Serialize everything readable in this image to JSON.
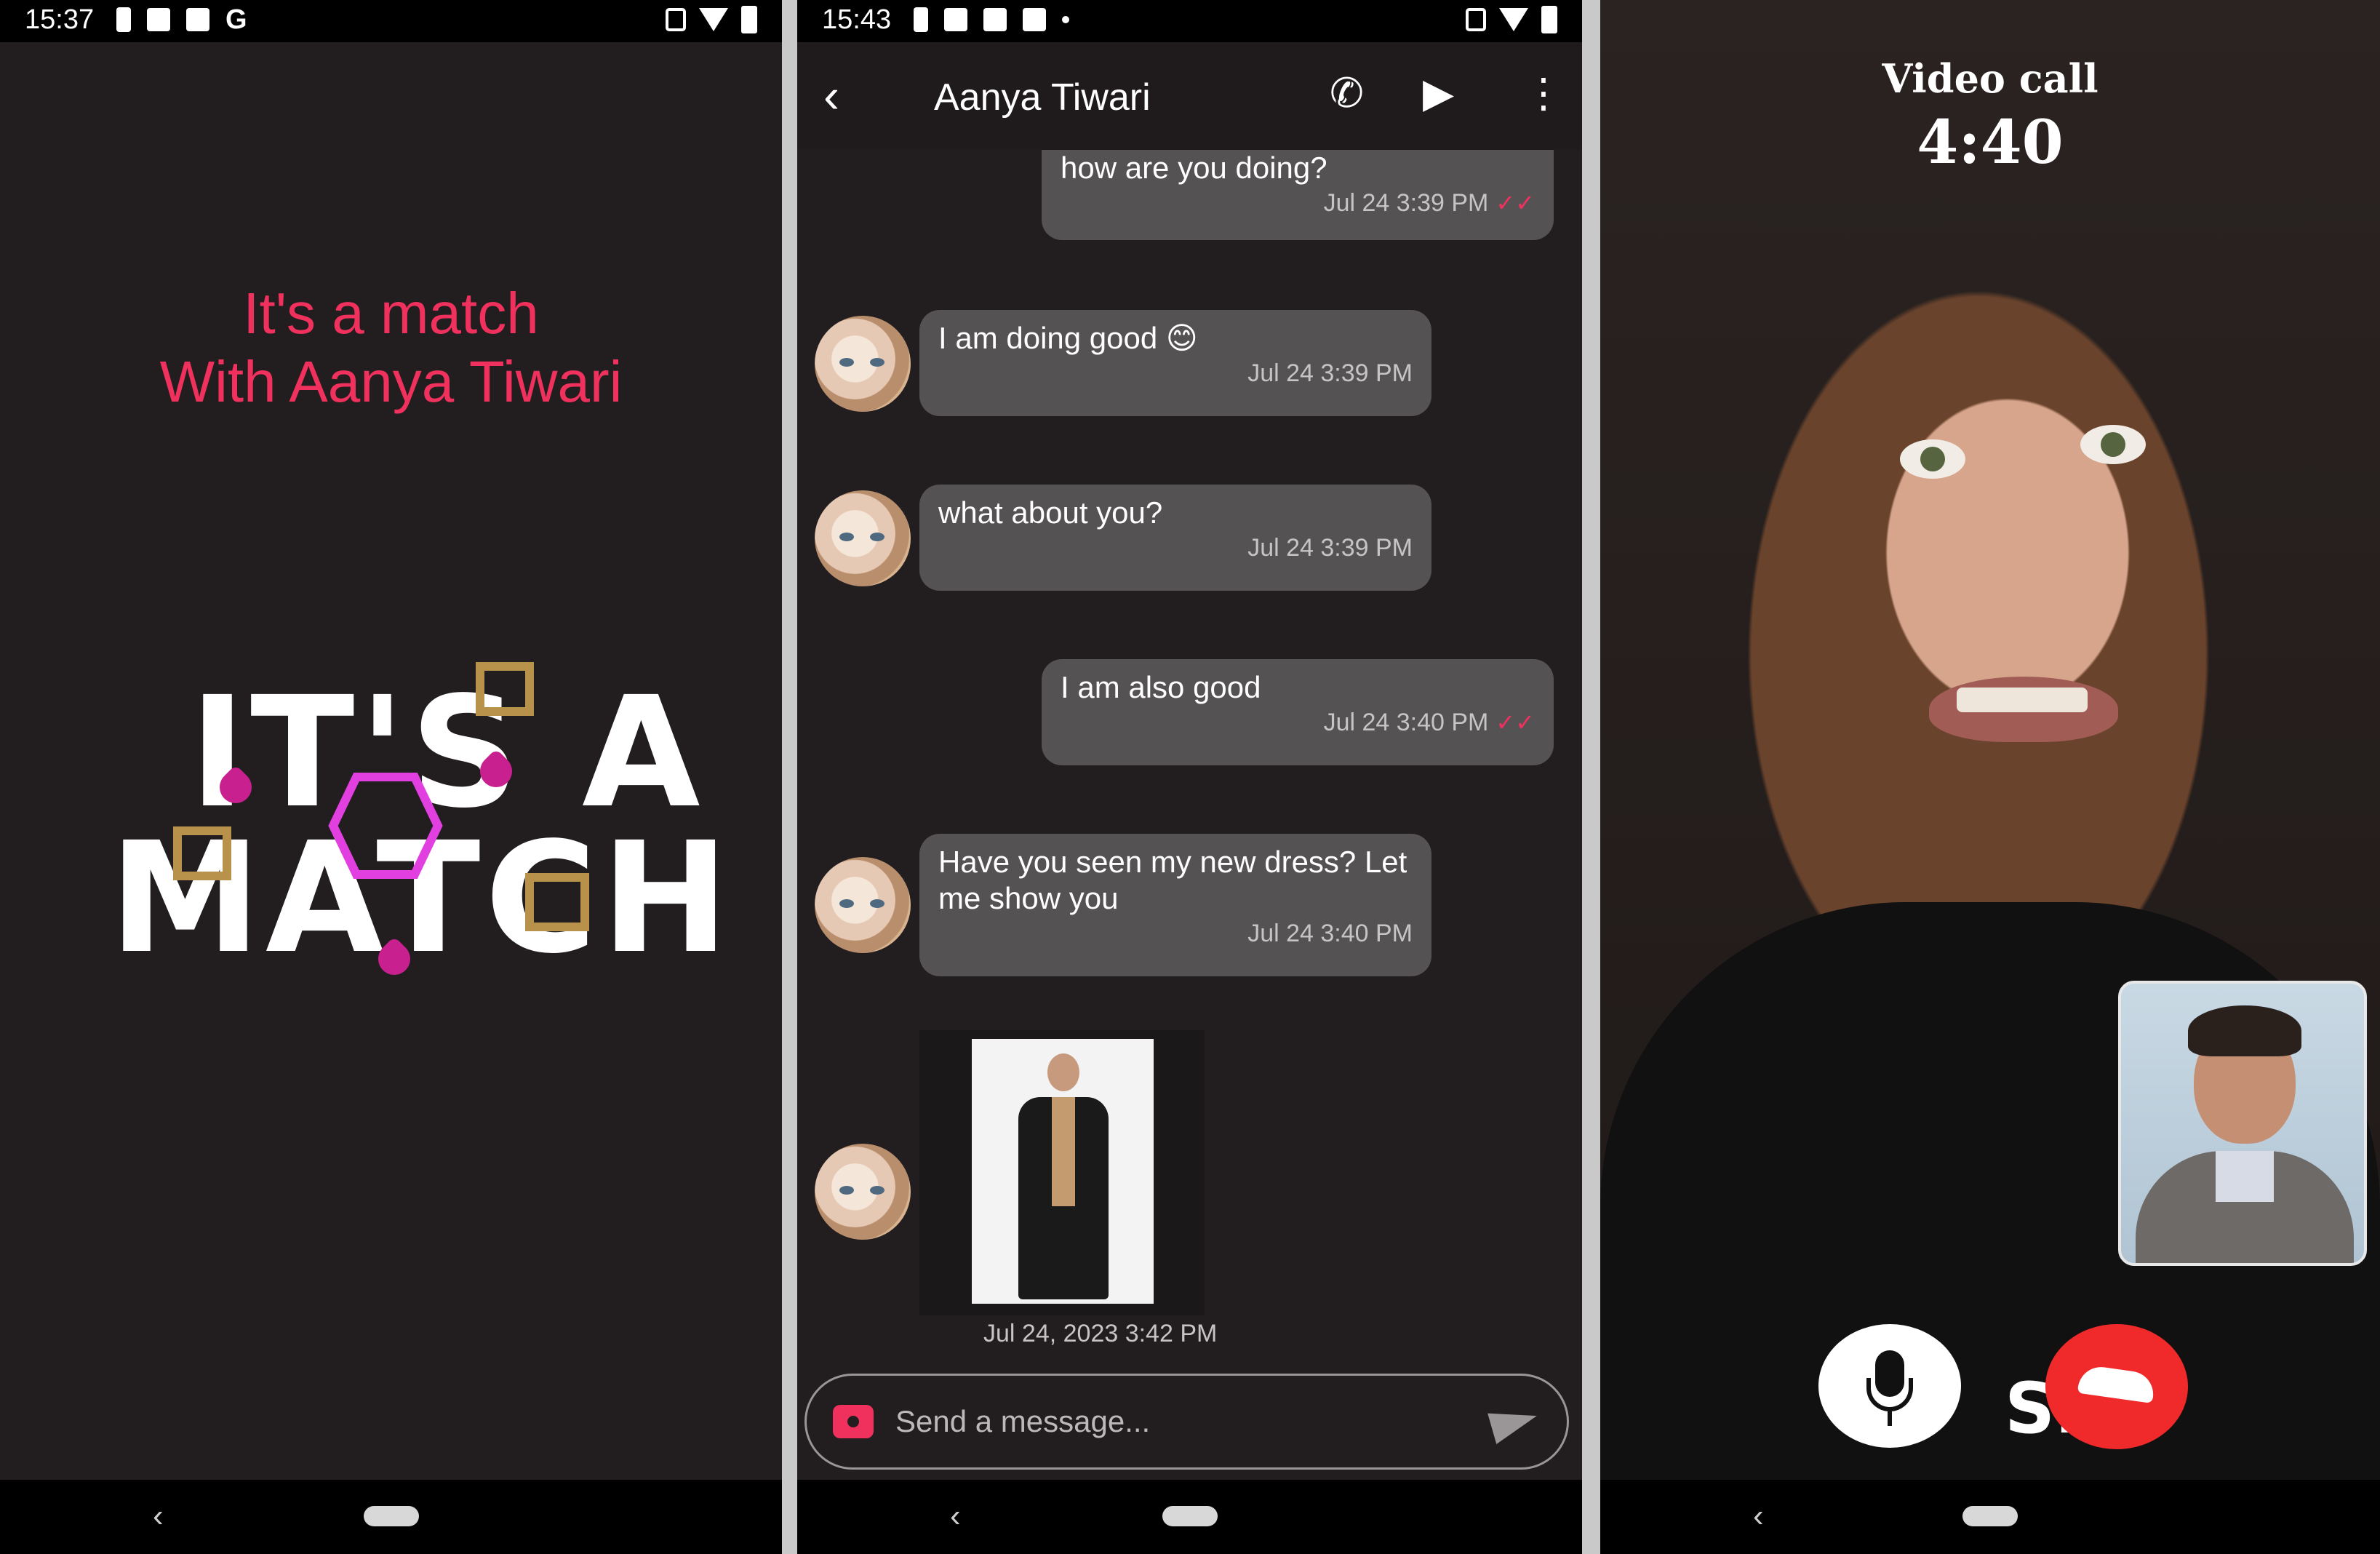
{
  "colors": {
    "accent": "#f0315d",
    "background": "#221e1f",
    "bubble": "#555254",
    "end_call": "#f02a2a"
  },
  "screen1": {
    "status_time": "15:37",
    "match_line1": "It's a match",
    "match_line2": "With Aanya Tiwari",
    "logo_line1": "IT'S A",
    "logo_line2": "MATCH"
  },
  "screen2": {
    "status_time": "15:43",
    "header_title": "Aanya Tiwari",
    "messages": [
      {
        "text": "how are you doing?",
        "time": "Jul 24 3:39 PM",
        "sent": true,
        "read_tick": "✓✓"
      },
      {
        "text": "I am doing good 😊",
        "time": "Jul 24 3:39 PM",
        "sent": false
      },
      {
        "text": "what about you?",
        "time": "Jul 24 3:39 PM",
        "sent": false
      },
      {
        "text": "I am also good",
        "time": "Jul 24 3:40 PM",
        "sent": true,
        "read_tick": "✓✓"
      },
      {
        "text": "Have you seen my new dress? Let me show you",
        "time": "Jul 24 3:40 PM",
        "sent": false
      }
    ],
    "image_time": "Jul 24, 2023 3:42 PM",
    "composer_placeholder": "Send a message..."
  },
  "screen3": {
    "title": "Video call",
    "timer": "4:40",
    "shirt_text": "SEA"
  },
  "icons": {
    "back": "‹",
    "call": "✆",
    "video": "▶",
    "menu": "⋮"
  }
}
